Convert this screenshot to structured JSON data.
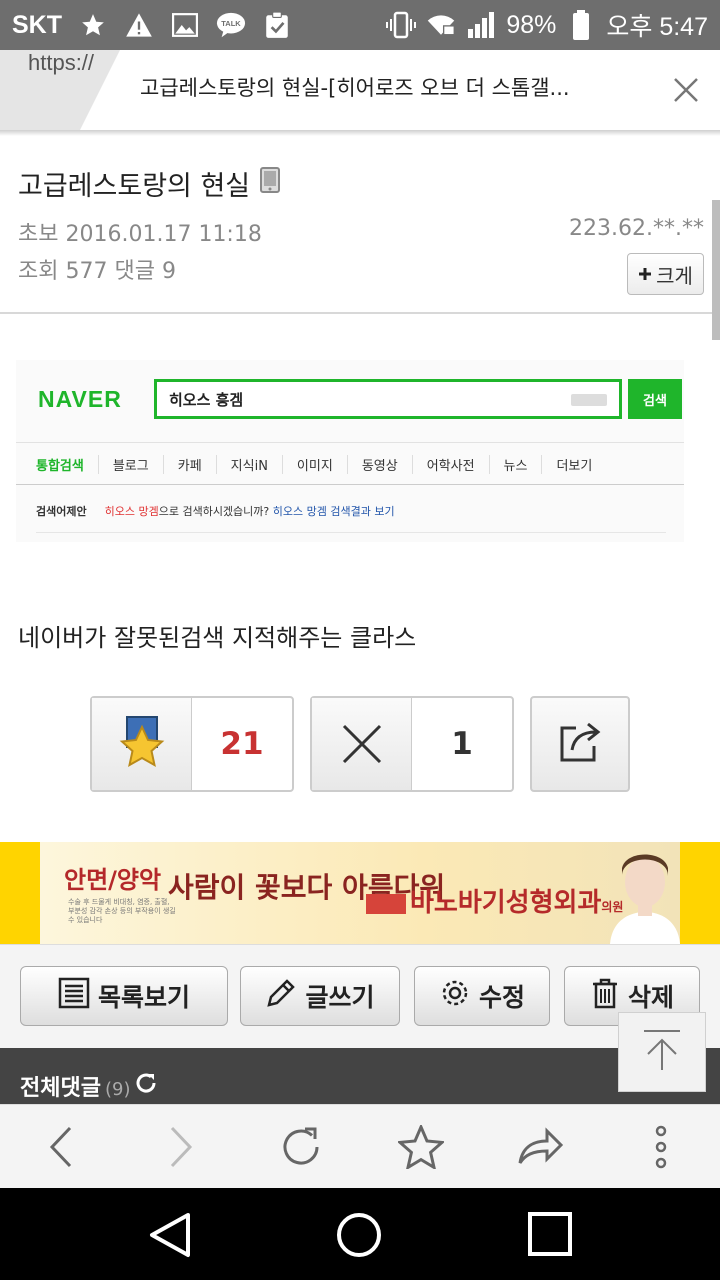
{
  "status_bar": {
    "carrier": "SKT",
    "battery": "98%",
    "time": "오후 5:47",
    "icons": [
      "star-icon",
      "warning-icon",
      "image-icon",
      "kakaotalk-icon",
      "clipboard-check-icon",
      "vibrate-icon",
      "wifi-icon",
      "signal-icon",
      "battery-icon"
    ],
    "talk_label": "TALK"
  },
  "browser_tab": {
    "url_prefix": "https://",
    "title": "고급레스토랑의 현실-[히어로즈 오브 더 스톰갤..."
  },
  "post": {
    "title": "고급레스토랑의 현실",
    "author": "초보",
    "date": "2016.01.17 11:18",
    "ip": "223.62.**.**",
    "views_label": "조회",
    "views": "577",
    "comments_label": "댓글",
    "comments": "9",
    "bigger_button": "크게",
    "body_text": "네이버가 잘못된검색 지적해주는 클라스"
  },
  "naver_capture": {
    "logo": "NAVER",
    "query": "히오스 흥겜",
    "search_button": "검색",
    "tabs": [
      "통합검색",
      "블로그",
      "카페",
      "지식iN",
      "이미지",
      "동영상",
      "어학사전",
      "뉴스",
      "더보기"
    ],
    "suggest_label": "검색어제안",
    "suggest_term": "히오스 망겜",
    "suggest_middle": "으로 검색하시겠습니까?",
    "suggest_link": "히오스 망겜 검색결과 보기"
  },
  "votes": {
    "up_count": "21",
    "down_count": "1"
  },
  "ad": {
    "line1": "안면/양악",
    "slogan": "사람이 꽃보다 아름다워",
    "clinic": "바노바기성형외과",
    "clinic_suffix": "의원",
    "fine_print": "수술 후 드물게 비대칭, 염증, 출혈, 부분성 감각 손상 등의 부작용이 생길 수 있습니다"
  },
  "actions": {
    "list": "목록보기",
    "write": "글쓰기",
    "edit": "수정",
    "delete": "삭제"
  },
  "comments_section": {
    "title": "전체댓글",
    "count": "(9)"
  }
}
